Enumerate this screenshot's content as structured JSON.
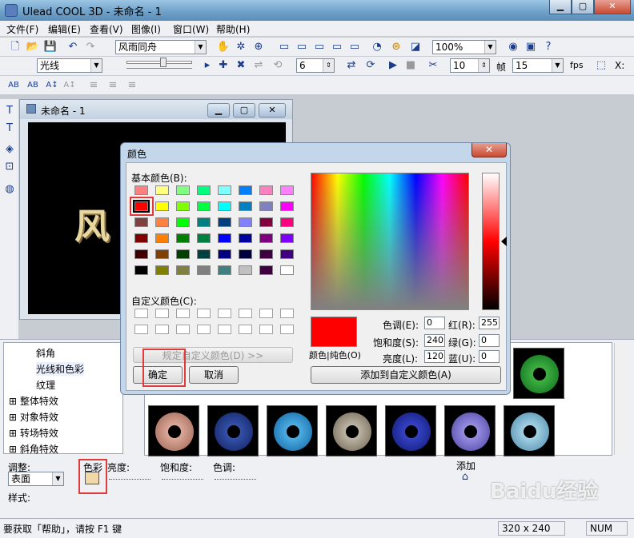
{
  "app": {
    "title": "Ulead COOL 3D - 未命名 - 1"
  },
  "menu": [
    "文件(F)",
    "编辑(E)",
    "查看(V)",
    "图像(I)",
    "窗口(W)",
    "帮助(H)"
  ],
  "toolbar1": {
    "font": "风雨同舟",
    "zoom": "100%"
  },
  "toolbar2": {
    "curve": "光线",
    "value": "6",
    "frame": "10",
    "frame_label": "帧",
    "fps": "15",
    "fps_label": "fps",
    "x_label": "X:"
  },
  "doc": {
    "title": "未命名 - 1",
    "canvas_text": "风"
  },
  "tree": {
    "items": [
      "斜角",
      "光线和色彩",
      "纹理",
      "整体特效",
      "对象特效",
      "转场特效",
      "斜角特效"
    ]
  },
  "props": {
    "adjust_label": "调整:",
    "surface": "表面",
    "color_label": "色彩",
    "brightness_label": "亮度:",
    "saturation_label": "饱和度:",
    "hue_label": "色调:",
    "add_label": "添加",
    "style_label": "样式:"
  },
  "status": {
    "help": "要获取「帮助」，请按 F1 键",
    "size": "320 x 240",
    "num": "NUM"
  },
  "dialog": {
    "title": "颜色",
    "close": "✕",
    "basic_label": "基本颜色(B):",
    "basic_colors": [
      "#ff8080",
      "#ffff80",
      "#80ff80",
      "#00ff80",
      "#80ffff",
      "#0080ff",
      "#ff80c0",
      "#ff80ff",
      "#ff0000",
      "#ffff00",
      "#80ff00",
      "#00ff40",
      "#00ffff",
      "#0080c0",
      "#8080c0",
      "#ff00ff",
      "#804040",
      "#ff8040",
      "#00ff00",
      "#008080",
      "#004080",
      "#8080ff",
      "#800040",
      "#ff0080",
      "#800000",
      "#ff8000",
      "#008000",
      "#008040",
      "#0000ff",
      "#0000a0",
      "#800080",
      "#8000ff",
      "#400000",
      "#804000",
      "#004000",
      "#004040",
      "#000080",
      "#000040",
      "#400040",
      "#400080",
      "#000000",
      "#808000",
      "#808040",
      "#808080",
      "#408080",
      "#c0c0c0",
      "#400040",
      "#ffffff"
    ],
    "custom_label": "自定义颜色(C):",
    "define_button": "规定自定义颜色(D) >>",
    "ok_button": "确定",
    "cancel_button": "取消",
    "solid_label": "颜色|纯色(O)",
    "hue_label": "色调(E):",
    "hue_value": "0",
    "sat_label": "饱和度(S):",
    "sat_value": "240",
    "lum_label": "亮度(L):",
    "lum_value": "120",
    "red_label": "红(R):",
    "red_value": "255",
    "green_label": "绿(G):",
    "green_value": "0",
    "blue_label": "蓝(U):",
    "blue_value": "0",
    "add_custom_button": "添加到自定义颜色(A)",
    "selected_color": "#ff0000"
  },
  "watermark": "Baidu经验"
}
